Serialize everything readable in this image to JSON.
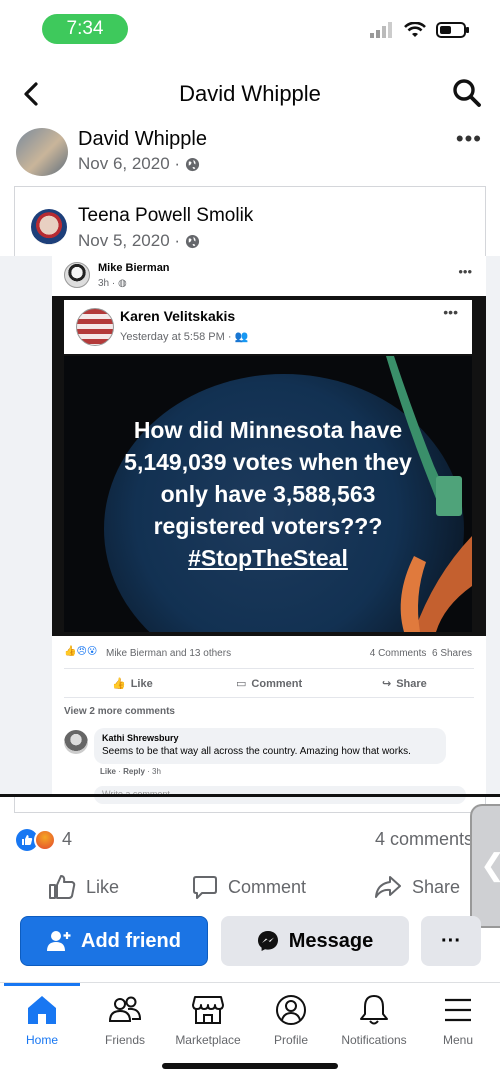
{
  "status_bar": {
    "time": "7:34"
  },
  "header": {
    "title": "David Whipple"
  },
  "post": {
    "author": "David Whipple",
    "date": "Nov 6, 2020 ·"
  },
  "shared": {
    "author": "Teena Powell Smolik",
    "date": "Nov 5, 2020 ·"
  },
  "screenshot": {
    "author": "Mike Bierman",
    "time": "3h · ",
    "card_author": "Karen Velitskakis",
    "card_time": "Yesterday at 5:58 PM ·",
    "meme_lines": [
      "How did Minnesota have",
      "5,149,039 votes when they",
      "only have 3,588,563",
      "registered voters???"
    ],
    "meme_tag": "#StopTheSteal",
    "reactions_text": "Mike Bierman and 13 others",
    "comments_shares": "4 Comments  6 Shares",
    "actions": {
      "like": "Like",
      "comment": "Comment",
      "share": "Share"
    },
    "view_more": "View 2 more comments",
    "comment": {
      "author": "Kathi Shrewsbury",
      "text": "Seems to be that way all across the country. Amazing how that works.",
      "meta_like": "Like",
      "meta_reply": "Reply",
      "meta_time": "3h"
    },
    "write_placeholder": "Write a comment..."
  },
  "reactions": {
    "count": "4",
    "comments": "4 comments"
  },
  "actions": {
    "like": "Like",
    "comment": "Comment",
    "share": "Share"
  },
  "profile_buttons": {
    "add_friend": "Add friend",
    "message": "Message",
    "more": "···"
  },
  "tabs": [
    {
      "label": "Home",
      "active": true
    },
    {
      "label": "Friends"
    },
    {
      "label": "Marketplace"
    },
    {
      "label": "Profile"
    },
    {
      "label": "Notifications"
    },
    {
      "label": "Menu"
    }
  ],
  "colors": {
    "brand": "#1877f2",
    "time_pill": "#3ec95c",
    "text_secondary": "#65676b"
  }
}
